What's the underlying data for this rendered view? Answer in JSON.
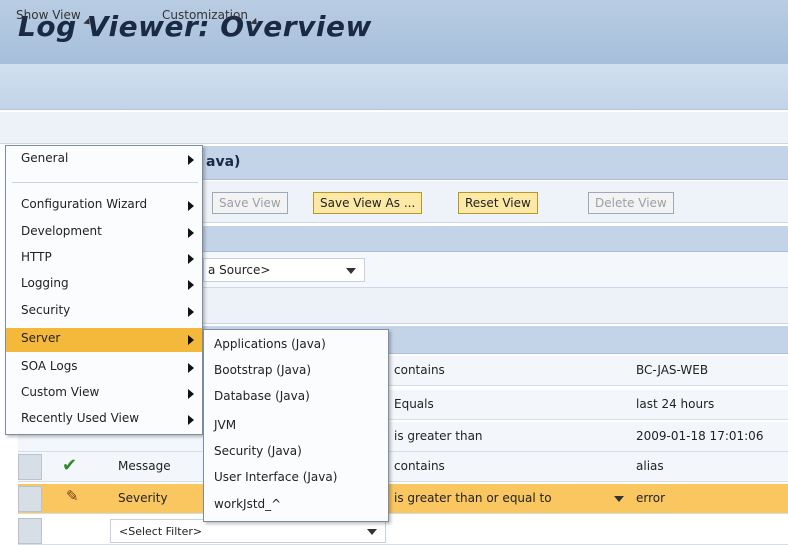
{
  "header": {
    "title": "Log Viewer: Overview"
  },
  "menubar": {
    "show_view": "Show View",
    "customization": "Customization"
  },
  "background": {
    "view_title_fragment": "ava)",
    "toolbar": {
      "save_view": "Save View",
      "save_view_as": "Save View As ...",
      "reset_view": "Reset View",
      "delete_view": "Delete View"
    },
    "source_select": "a Source>",
    "filter_rows": [
      {
        "operator": "contains",
        "value": "BC-JAS-WEB"
      },
      {
        "operator": "Equals",
        "value": "last 24 hours"
      },
      {
        "operator": "is greater than",
        "value": "2009-01-18 17:01:06"
      },
      {
        "field": "Message",
        "operator": "contains",
        "value": "alias"
      },
      {
        "field": "Severity",
        "operator": "is greater than or equal to",
        "value": "error"
      }
    ],
    "select_filter": "<Select Filter>"
  },
  "menu": {
    "items": [
      {
        "label": "General"
      },
      {
        "label": "Configuration Wizard"
      },
      {
        "label": "Development"
      },
      {
        "label": "HTTP"
      },
      {
        "label": "Logging"
      },
      {
        "label": "Security"
      },
      {
        "label": "Server"
      },
      {
        "label": "SOA Logs"
      },
      {
        "label": "Custom View"
      },
      {
        "label": "Recently Used View"
      }
    ]
  },
  "submenu": {
    "items": [
      "Applications (Java)",
      "Bootstrap (Java)",
      "Database (Java)",
      "JVM",
      "Security (Java)",
      "User Interface (Java)",
      "workJstd_^"
    ]
  },
  "colors": {
    "highlight": "#f4b93a",
    "selected_row": "#f9c660",
    "title_bar": "#b0c6df",
    "check": "#2e8b2e"
  }
}
